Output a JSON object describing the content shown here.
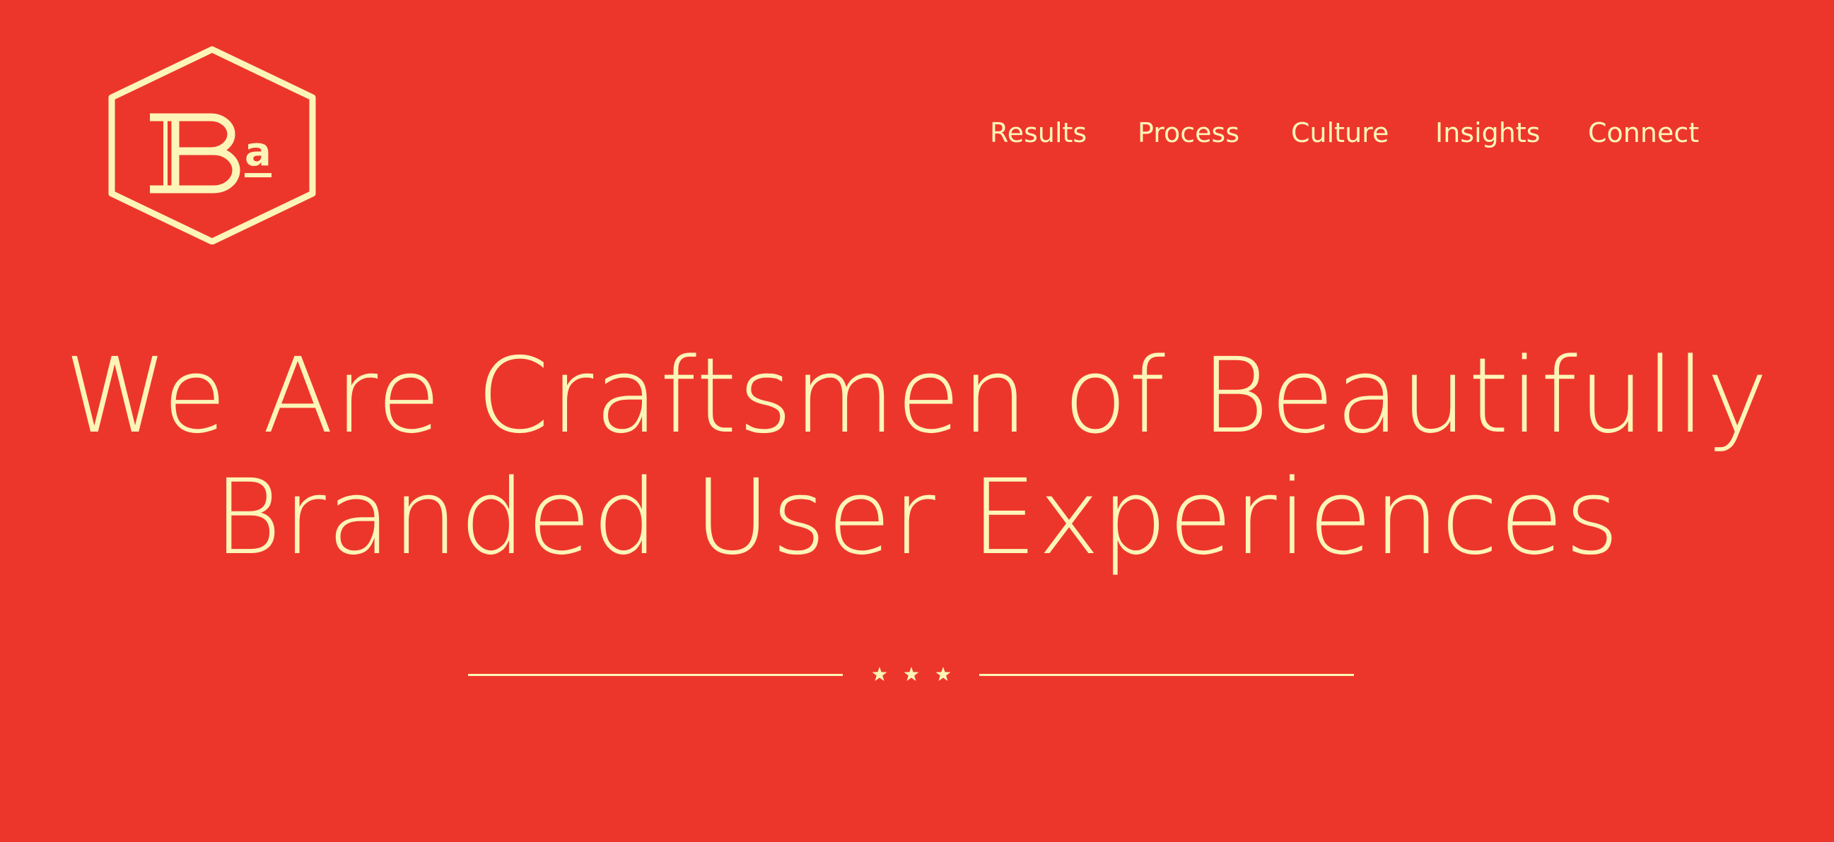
{
  "brand": {
    "logo_letters": "Ba",
    "logo_icon": "hexagon-monogram",
    "color_background": "#ED362B",
    "color_foreground": "#FDF5B8"
  },
  "nav": {
    "items": [
      {
        "label": "Results"
      },
      {
        "label": "Process"
      },
      {
        "label": "Culture"
      },
      {
        "label": "Insights"
      },
      {
        "label": "Connect"
      }
    ]
  },
  "hero": {
    "headline_line1": "We Are Craftsmen of Beautifully",
    "headline_line2": "Branded User Experiences"
  },
  "divider": {
    "icon": "star-icon",
    "star_count": 3
  }
}
